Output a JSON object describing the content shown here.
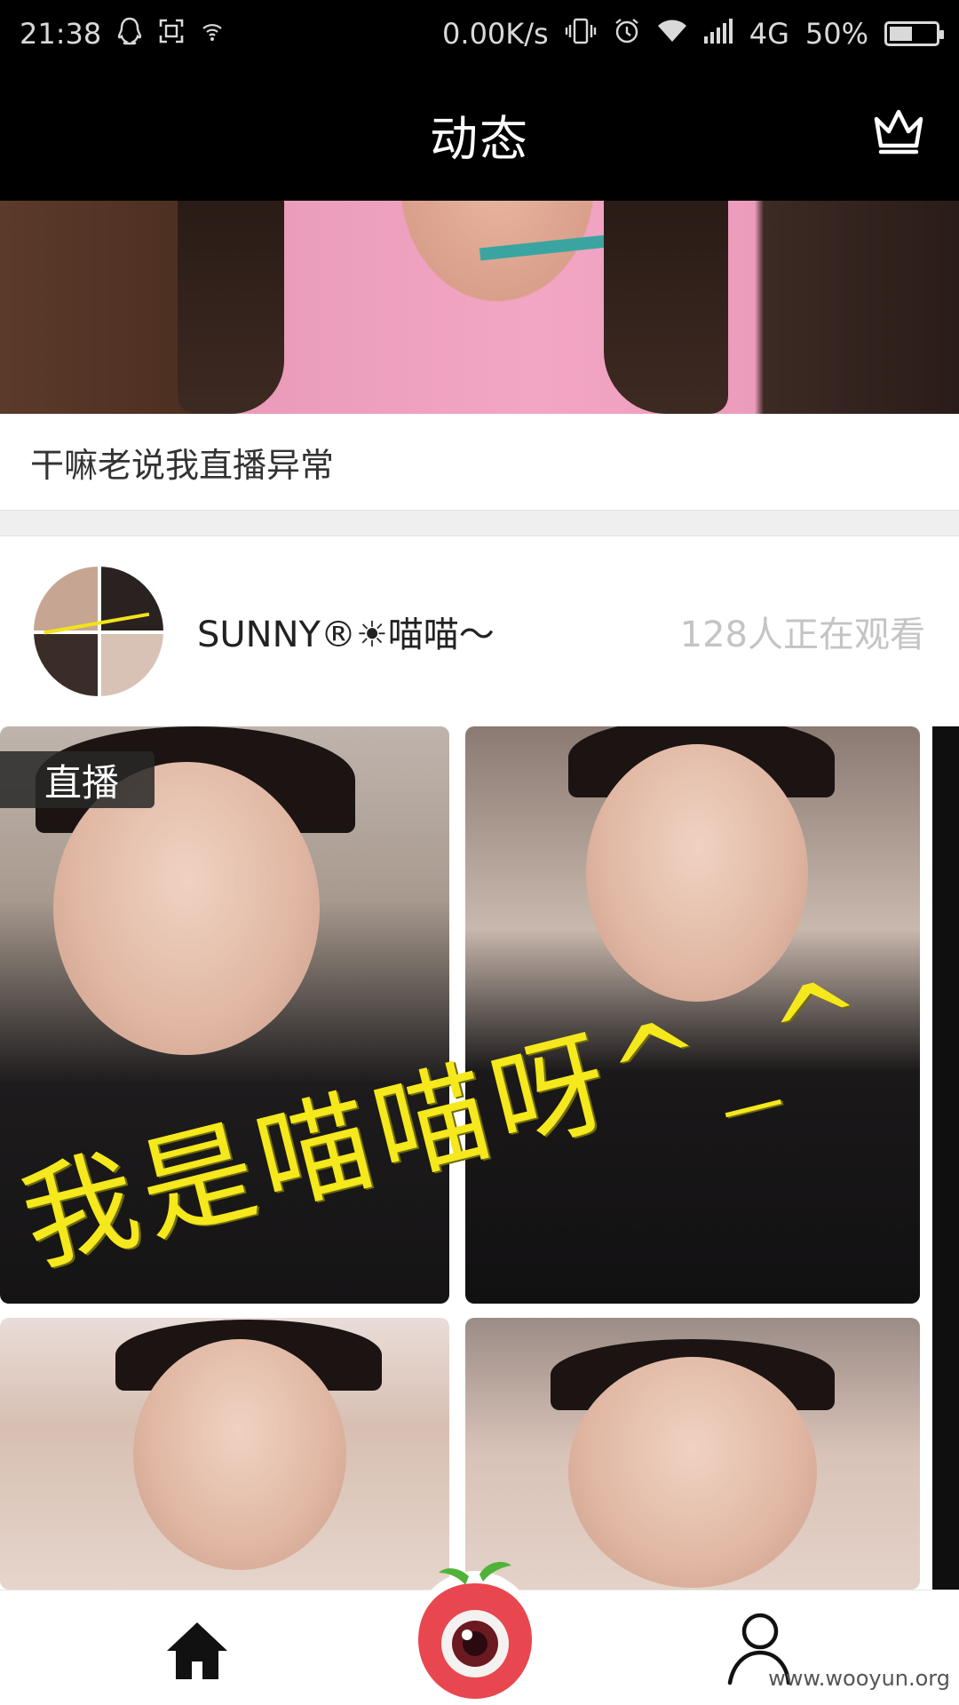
{
  "status_bar": {
    "time": "21:38",
    "net_speed": "0.00K/s",
    "network": "4G",
    "battery": "50%",
    "battery_level": 0.5,
    "icons": [
      "qq-icon",
      "screenshot-icon",
      "wifi-hotspot-icon",
      "vibrate-icon",
      "alarm-icon",
      "wifi-icon",
      "signal-icon",
      "battery-icon"
    ]
  },
  "header": {
    "title": "动态",
    "right_icon": "crown-icon"
  },
  "feed": {
    "post1": {
      "caption": "干嘛老说我直播异常"
    },
    "post2": {
      "username": "SUNNY®☀喵喵～",
      "viewers": "128人正在观看",
      "badge": "直播"
    }
  },
  "bottom_nav": {
    "items": [
      "home-icon",
      "live-camera-icon",
      "profile-icon"
    ]
  },
  "watermark": "www.wooyun.org",
  "colors": {
    "bar_bg": "#000000",
    "viewers_text": "#c4c4c4",
    "accent_red": "#e8474f",
    "leaf_green": "#4fb33a"
  }
}
